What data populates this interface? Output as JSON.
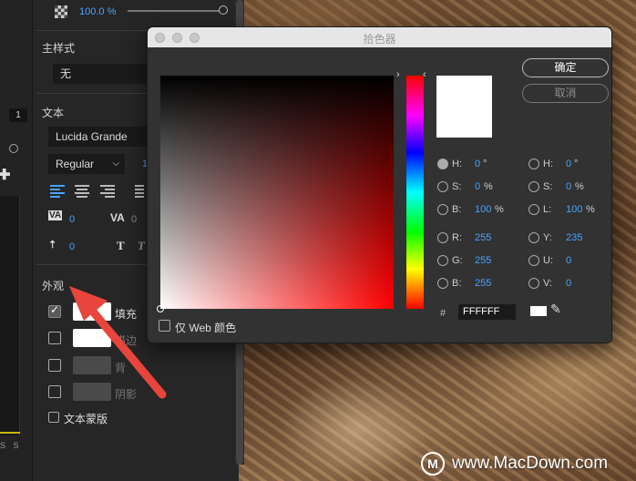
{
  "panel": {
    "opacity_value": "100.0 %",
    "master_style_title": "主样式",
    "master_style_value": "无",
    "text_title": "文本",
    "font_family": "Lucida Grande",
    "font_style": "Regular",
    "font_size_partial": "1",
    "kerning_icon": "VA",
    "kerning_value": "0",
    "tracking_value": "0",
    "tracking_icon": "VA",
    "baseline_value": "0",
    "faux_bold_icon": "T",
    "faux_italic_icon": "T",
    "appearance_title": "外观",
    "fill_label": "填充",
    "stroke_label": "描边",
    "background_label": "背",
    "shadow_label": "阴影",
    "text_mask_label": "文本蒙版",
    "fill_checked": true,
    "stroke_checked": false
  },
  "left_edge": {
    "number": "1",
    "ss": "S S"
  },
  "dialog": {
    "title": "拾色器",
    "ok_label": "确定",
    "cancel_label": "取消",
    "selected_color": "#FFFFFF",
    "hex_value": "FFFFFF",
    "hex_prefix": "#",
    "web_only_label": "仅 Web 颜色",
    "hsb": [
      {
        "label": "H:",
        "value": "0",
        "unit": "°"
      },
      {
        "label": "S:",
        "value": "0",
        "unit": "%"
      },
      {
        "label": "B:",
        "value": "100",
        "unit": "%"
      }
    ],
    "rgb": [
      {
        "label": "R:",
        "value": "255"
      },
      {
        "label": "G:",
        "value": "255"
      },
      {
        "label": "B:",
        "value": "255"
      }
    ],
    "hsl": [
      {
        "label": "H:",
        "value": "0",
        "unit": "°"
      },
      {
        "label": "S:",
        "value": "0",
        "unit": "%"
      },
      {
        "label": "L:",
        "value": "100",
        "unit": "%"
      }
    ],
    "yuv": [
      {
        "label": "Y:",
        "value": "235"
      },
      {
        "label": "U:",
        "value": "0"
      },
      {
        "label": "V:",
        "value": "0"
      }
    ]
  },
  "watermark": {
    "logo": "M",
    "text": "www.MacDown.com"
  },
  "colors": {
    "accent_blue": "#4aa3ff",
    "arrow_red": "#e8453c"
  }
}
